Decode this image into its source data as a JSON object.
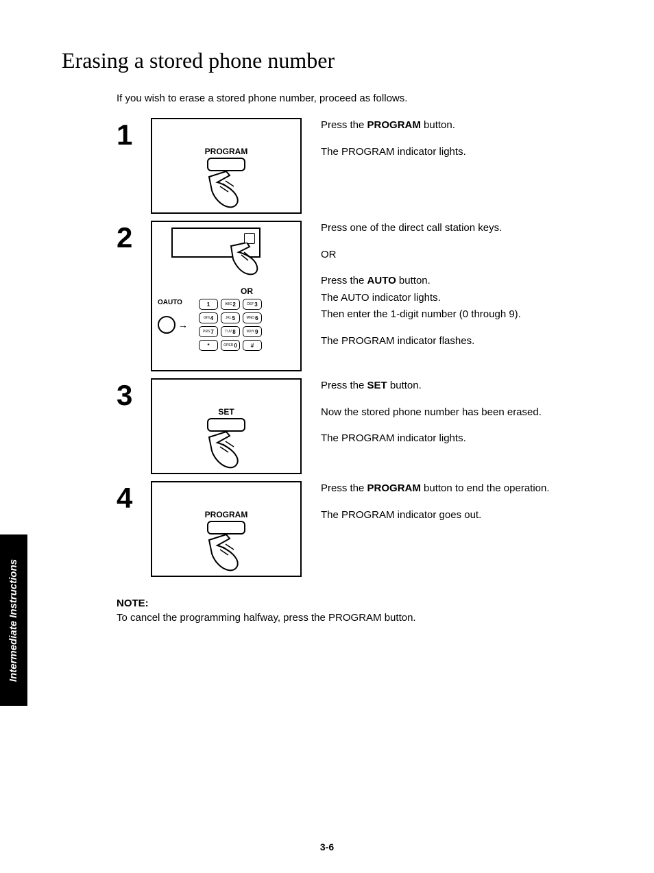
{
  "title": "Erasing a stored phone number",
  "intro": "If you wish to erase a stored phone number, proceed as follows.",
  "side_tab": "Intermediate Instructions",
  "page_number": "3-6",
  "steps": {
    "s1": {
      "num": "1",
      "fig_label": "PROGRAM",
      "line1_a": "Press the ",
      "line1_b": "PROGRAM",
      "line1_c": " button.",
      "line2": "The PROGRAM indicator lights."
    },
    "s2": {
      "num": "2",
      "fig_or": "OR",
      "fig_auto": "OAUTO",
      "line1": "Press one of the direct call station keys.",
      "line2": "OR",
      "line3_a": "Press the ",
      "line3_b": "AUTO",
      "line3_c": " button.",
      "line4": "The AUTO indicator lights.",
      "line5": "Then enter the 1-digit number (0 through 9).",
      "line6": "The PROGRAM indicator flashes.",
      "keys": [
        {
          "sub": "",
          "d": "1"
        },
        {
          "sub": "ABC",
          "d": "2"
        },
        {
          "sub": "DEF",
          "d": "3"
        },
        {
          "sub": "GHI",
          "d": "4"
        },
        {
          "sub": "JKL",
          "d": "5"
        },
        {
          "sub": "MNO",
          "d": "6"
        },
        {
          "sub": "PRS",
          "d": "7"
        },
        {
          "sub": "TUV",
          "d": "8"
        },
        {
          "sub": "WXY",
          "d": "9"
        },
        {
          "sub": "",
          "d": "*"
        },
        {
          "sub": "OPER",
          "d": "0"
        },
        {
          "sub": "",
          "d": "#"
        }
      ]
    },
    "s3": {
      "num": "3",
      "fig_label": "SET",
      "line1_a": "Press the ",
      "line1_b": "SET",
      "line1_c": " button.",
      "line2": "Now the stored phone number has been erased.",
      "line3": "The PROGRAM indicator lights."
    },
    "s4": {
      "num": "4",
      "fig_label": "PROGRAM",
      "line1_a": "Press the ",
      "line1_b": "PROGRAM",
      "line1_c": " button to end the operation.",
      "line2": "The PROGRAM indicator goes out."
    }
  },
  "note": {
    "heading": "NOTE:",
    "body": "To cancel the programming halfway, press the PROGRAM button."
  }
}
